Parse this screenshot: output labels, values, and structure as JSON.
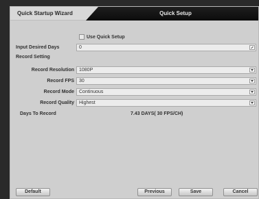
{
  "tabs": {
    "wizard": "Quick Startup Wizard",
    "quick": "Quick Setup"
  },
  "use_quick_setup": {
    "label": "Use Quick Setup",
    "checked": false
  },
  "input_days": {
    "label": "Input Desired Days",
    "value": "0"
  },
  "record_setting": {
    "title": "Record Setting",
    "resolution": {
      "label": "Record Resolution",
      "value": "1080P"
    },
    "fps": {
      "label": "Record FPS",
      "value": "30"
    },
    "mode": {
      "label": "Record Mode",
      "value": "Continuous"
    },
    "quality": {
      "label": "Record Quality",
      "value": "Highest"
    },
    "days_to_record": {
      "label": "Days To Record",
      "value": "7.43 DAYS( 30 FPS/CH)"
    }
  },
  "buttons": {
    "default": "Default",
    "previous": "Previous",
    "save": "Save",
    "cancel": "Cancel"
  },
  "icons": [
    "edit-icon",
    "chevron-down-icon"
  ],
  "colors": {
    "panel": "#cfcfcf",
    "active_tab": "#0c0c0c",
    "field": "#ececec"
  }
}
